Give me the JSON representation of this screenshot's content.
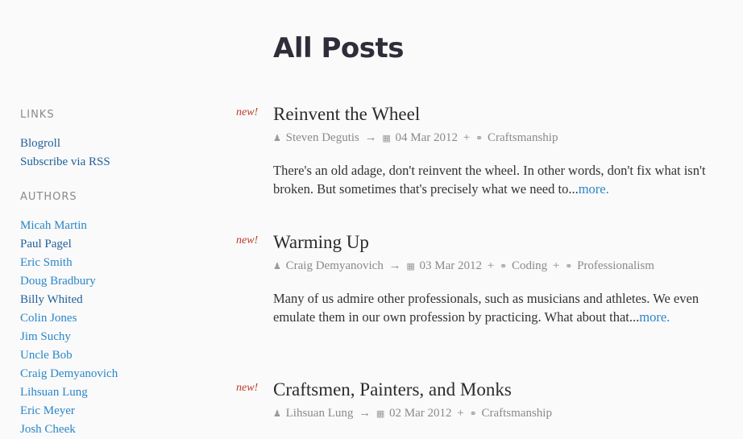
{
  "page": {
    "title": "All Posts"
  },
  "sidebar": {
    "links_heading": "LINKS",
    "links": [
      {
        "label": "Blogroll"
      },
      {
        "label": "Subscribe via RSS"
      }
    ],
    "authors_heading": "AUTHORS",
    "authors": [
      {
        "label": "Micah Martin"
      },
      {
        "label": "Paul Pagel"
      },
      {
        "label": "Eric Smith"
      },
      {
        "label": "Doug Bradbury"
      },
      {
        "label": "Billy Whited"
      },
      {
        "label": "Colin Jones"
      },
      {
        "label": "Jim Suchy"
      },
      {
        "label": "Uncle Bob"
      },
      {
        "label": "Craig Demyanovich"
      },
      {
        "label": "Lihsuan Lung"
      },
      {
        "label": "Eric Meyer"
      },
      {
        "label": "Josh Cheek"
      }
    ]
  },
  "posts": [
    {
      "badge": "new!",
      "title": "Reinvent the Wheel",
      "author": "Steven Degutis",
      "date": "04 Mar 2012",
      "tags": [
        "Craftsmanship"
      ],
      "excerpt": "There's an old adage, don't reinvent the wheel. In other words, don't fix what isn't broken. But sometimes that's precisely what we need to...",
      "more": "more."
    },
    {
      "badge": "new!",
      "title": "Warming Up",
      "author": "Craig Demyanovich",
      "date": "03 Mar 2012",
      "tags": [
        "Coding",
        "Professionalism"
      ],
      "excerpt": "Many of us admire other professionals, such as musicians and athletes. We even emulate them in our own profession by practicing. What about that...",
      "more": "more."
    },
    {
      "badge": "new!",
      "title": "Craftsmen, Painters, and Monks",
      "author": "Lihsuan Lung",
      "date": "02 Mar 2012",
      "tags": [
        "Craftsmanship"
      ]
    }
  ],
  "icons": {
    "author": "user-icon",
    "date": "calendar-icon",
    "tag": "tag-icon"
  },
  "colors": {
    "link": "#2a86c8",
    "badge": "#c0392b",
    "meta": "#8a8a8a"
  }
}
